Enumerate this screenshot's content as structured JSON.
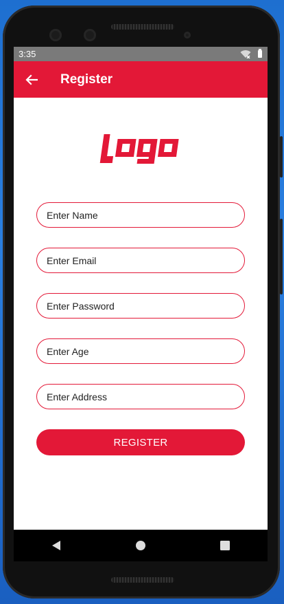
{
  "status_bar": {
    "time": "3:35",
    "wifi_icon": "wifi-off-icon",
    "battery_icon": "battery-icon"
  },
  "app_bar": {
    "title": "Register",
    "back_icon": "arrow-back-icon"
  },
  "logo": {
    "text": "logo",
    "color": "#e31837"
  },
  "form": {
    "name_placeholder": "Enter Name",
    "email_placeholder": "Enter Email",
    "password_placeholder": "Enter Password",
    "age_placeholder": "Enter Age",
    "address_placeholder": "Enter Address",
    "register_label": "REGISTER"
  },
  "nav_bar": {
    "back_icon": "nav-back-icon",
    "home_icon": "nav-home-icon",
    "recents_icon": "nav-recents-icon"
  },
  "colors": {
    "accent": "#e31837",
    "status_bar": "#7a7a7a",
    "background": "#ffffff"
  }
}
